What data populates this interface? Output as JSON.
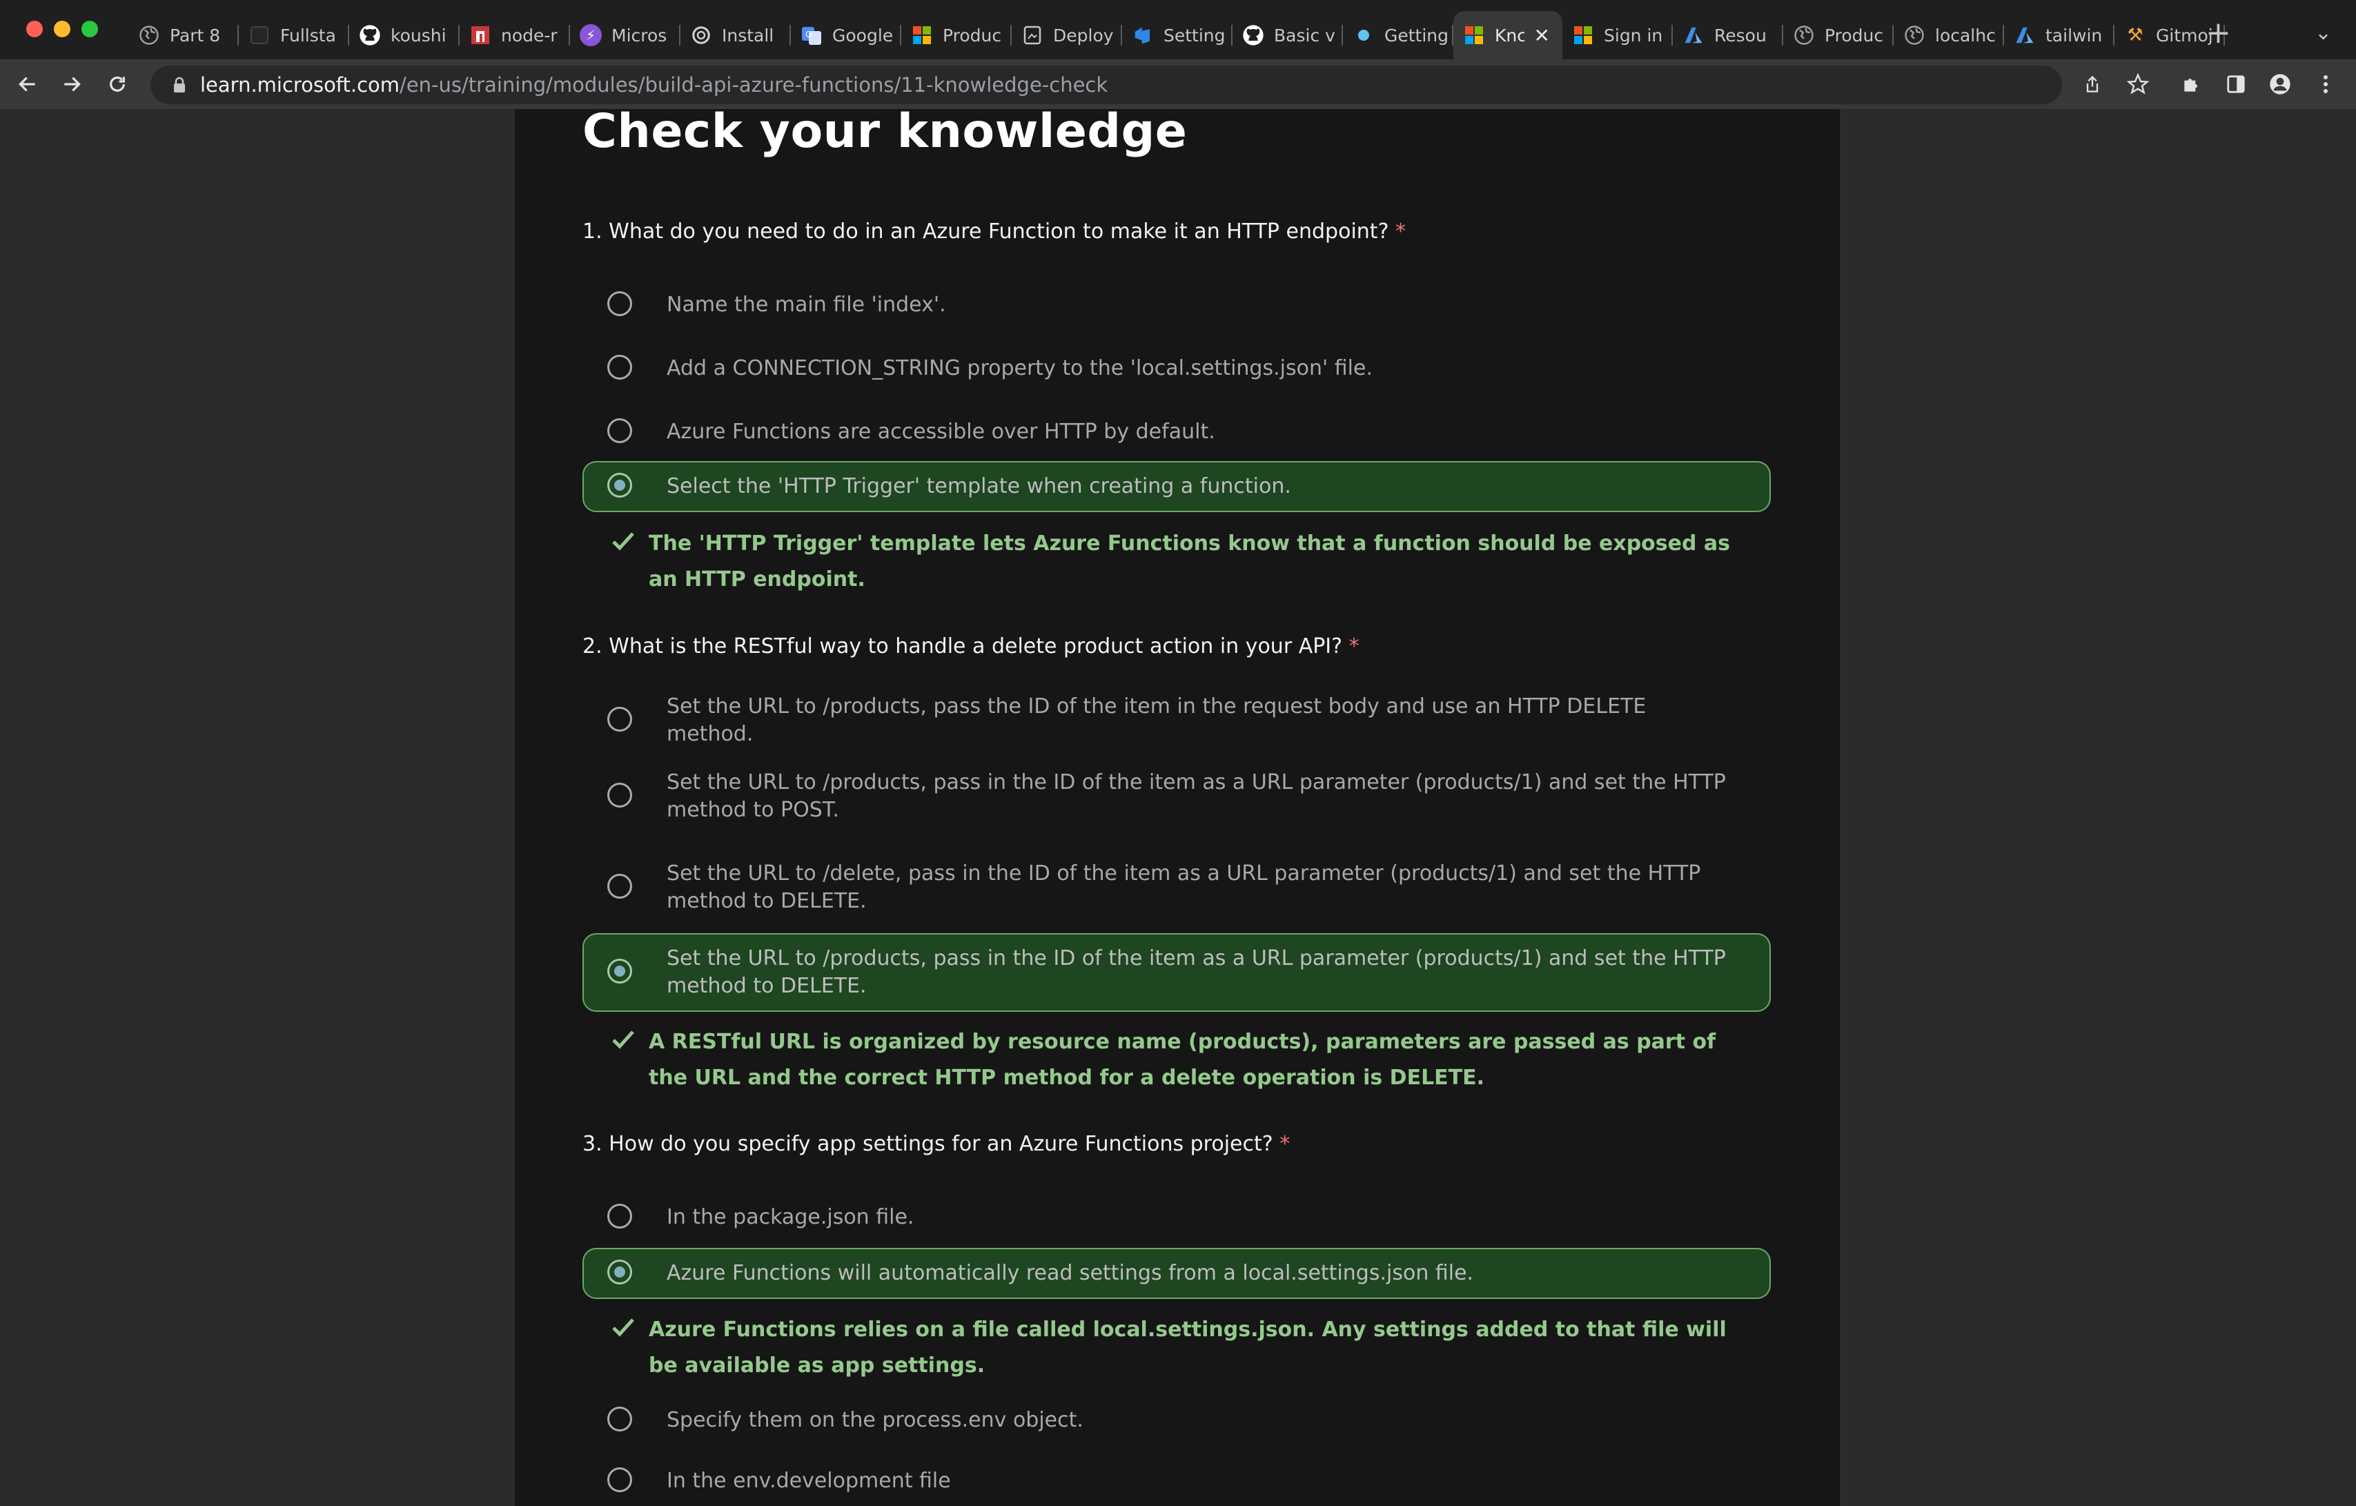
{
  "browser": {
    "tabs": [
      {
        "label": "Part 8",
        "icon": "globe-icon",
        "color": "#9aa0a6"
      },
      {
        "label": "Fullsta",
        "icon": "dark-square-icon",
        "color": "#333333"
      },
      {
        "label": "koushi",
        "icon": "github-icon",
        "color": "#ffffff"
      },
      {
        "label": "node-r",
        "icon": "npm-icon",
        "color": "#cb3837"
      },
      {
        "label": "Micros",
        "icon": "bolt-icon",
        "color": "#8a55d8"
      },
      {
        "label": "Install",
        "icon": "openai-icon",
        "color": "#9aa0a6"
      },
      {
        "label": "Google",
        "icon": "translate-icon",
        "color": "#4c8bf5"
      },
      {
        "label": "Produc",
        "icon": "microsoft-icon",
        "color": "#f25022"
      },
      {
        "label": "Deploy",
        "icon": "document-icon",
        "color": "#9aa0a6"
      },
      {
        "label": "Setting",
        "icon": "devops-icon",
        "color": "#2f88e6"
      },
      {
        "label": "Basic v",
        "icon": "github-icon",
        "color": "#ffffff"
      },
      {
        "label": "Getting",
        "icon": "circle-icon",
        "color": "#61c3f2"
      },
      {
        "label": "Knc",
        "icon": "microsoft-icon",
        "color": "#f25022",
        "active": true
      },
      {
        "label": "Sign in",
        "icon": "microsoft-icon",
        "color": "#f25022"
      },
      {
        "label": "Resou",
        "icon": "azure-icon",
        "color": "#3a8ee6"
      },
      {
        "label": "Produc",
        "icon": "globe-icon",
        "color": "#9aa0a6"
      },
      {
        "label": "localhc",
        "icon": "globe-icon",
        "color": "#9aa0a6"
      },
      {
        "label": "tailwin",
        "icon": "azure-icon",
        "color": "#3a8ee6"
      },
      {
        "label": "Gitmoj",
        "icon": "tools-icon",
        "color": "#f0a23b"
      }
    ],
    "url_host": "learn.microsoft.com",
    "url_path": "/en-us/training/modules/build-api-azure-functions/11-knowledge-check"
  },
  "page": {
    "title": "Check your knowledge",
    "required_mark": "*",
    "questions": [
      {
        "text": "1. What do you need to do in an Azure Function to make it an HTTP endpoint?",
        "options": [
          {
            "text": "Name the main file 'index'."
          },
          {
            "text": "Add a CONNECTION_STRING property to the 'local.settings.json' file."
          },
          {
            "text": "Azure Functions are accessible over HTTP by default."
          },
          {
            "text": "Select the 'HTTP Trigger' template when creating a function.",
            "selected": true,
            "correct": true
          }
        ],
        "feedback": "The 'HTTP Trigger' template lets Azure Functions know that a function should be exposed as an HTTP endpoint."
      },
      {
        "text": "2. What is the RESTful way to handle a delete product action in your API?",
        "options": [
          {
            "text": "Set the URL to /products, pass the ID of the item in the request body and use an HTTP DELETE method."
          },
          {
            "text": "Set the URL to /products, pass in the ID of the item as a URL parameter (products/1) and set the HTTP method to POST."
          },
          {
            "text": "Set the URL to /delete, pass in the ID of the item as a URL parameter (products/1) and set the HTTP method to DELETE."
          },
          {
            "text": "Set the URL to /products, pass in the ID of the item as a URL parameter (products/1) and set the HTTP method to DELETE.",
            "selected": true,
            "correct": true
          }
        ],
        "feedback": "A RESTful URL is organized by resource name (products), parameters are passed as part of the URL and the correct HTTP method for a delete operation is DELETE."
      },
      {
        "text": "3. How do you specify app settings for an Azure Functions project?",
        "options": [
          {
            "text": "In the package.json file."
          },
          {
            "text": "Azure Functions will automatically read settings from a local.settings.json file.",
            "selected": true,
            "correct": true
          },
          {
            "text": "Specify them on the process.env object."
          },
          {
            "text": "In the env.development file"
          }
        ],
        "feedback": "Azure Functions relies on a file called local.settings.json. Any settings added to that file will be available as app settings."
      }
    ]
  }
}
